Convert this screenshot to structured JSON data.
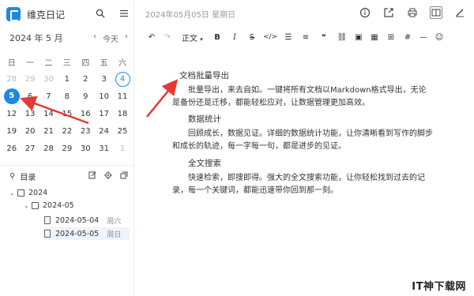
{
  "app": {
    "title": "维克日记"
  },
  "calendar": {
    "month_label": "2024 年 5 月",
    "today_label": "今天",
    "weekdays": [
      "日",
      "一",
      "二",
      "三",
      "四",
      "五",
      "六"
    ],
    "rows": [
      [
        "28",
        "29",
        "30",
        "1",
        "2",
        "3",
        "4"
      ],
      [
        "5",
        "6",
        "7",
        "8",
        "9",
        "10",
        "11"
      ],
      [
        "12",
        "13",
        "14",
        "15",
        "16",
        "17",
        "18"
      ],
      [
        "19",
        "20",
        "21",
        "22",
        "23",
        "24",
        "25"
      ],
      [
        "26",
        "27",
        "28",
        "29",
        "30",
        "31",
        "1"
      ]
    ],
    "selected": "5",
    "today": "4"
  },
  "toc": {
    "label": "目录",
    "tree": {
      "year": "2024",
      "month": "2024-05",
      "entries": [
        {
          "date": "2024-05-04",
          "weekday": "周六"
        },
        {
          "date": "2024-05-05",
          "weekday": "周日"
        }
      ]
    }
  },
  "editor": {
    "date_line": "2024年05月05日 星期日",
    "format_select": "正文",
    "sections": [
      {
        "heading": "文档批量导出",
        "body": "批量导出，来去自如。一键将所有文档以Markdown格式导出，无论是备份还是迁移，都能轻松应对，让数据管理更加高效。"
      },
      {
        "heading": "数据统计",
        "body": "回顾成长，数据见证。详细的数据统计功能，让你清晰看到写作的脚步和成长的轨迹，每一字每一句，都是进步的见证。"
      },
      {
        "heading": "全文搜索",
        "body": "快速检索，即搜即得。强大的全文搜索功能，让你轻松找到过去的记录，每一个关键词，都能迅速带你回到那一刻。"
      }
    ]
  },
  "watermark": "IT神下载网",
  "accent": "#1e88e5",
  "annotation_color": "#e53935"
}
